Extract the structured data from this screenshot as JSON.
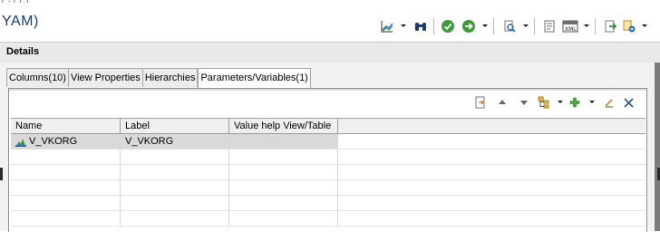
{
  "header": {
    "title": "YAM)",
    "cutoff_text": "/ . / / \\"
  },
  "toolbar_icons": [
    "chart-icon",
    "dropdown-arrow",
    "binoculars-icon",
    "validate-icon",
    "run-icon",
    "dropdown-arrow",
    "data-preview-icon",
    "dropdown-arrow",
    "copy-icon",
    "xml-icon",
    "dropdown-arrow",
    "import-icon",
    "deploy-icon",
    "dropdown-arrow"
  ],
  "details": {
    "title": "Details"
  },
  "tabs": [
    {
      "label": "Columns(10)"
    },
    {
      "label": "View Properties"
    },
    {
      "label": "Hierarchies"
    },
    {
      "label": "Parameters/Variables(1)",
      "active": true
    }
  ],
  "inner_toolbar_icons": [
    "export-icon",
    "move-up-icon",
    "move-down-icon",
    "hierarchy-icon",
    "dropdown-arrow",
    "add-icon",
    "dropdown-arrow",
    "edit-icon",
    "delete-icon"
  ],
  "table": {
    "columns": [
      "Name",
      "Label",
      "Value help View/Table"
    ],
    "rows": [
      {
        "name": "V_VKORG",
        "label": "V_VKORG",
        "value_help": "",
        "icon": "variable-icon"
      }
    ]
  },
  "colors": {
    "title": "#1c3f73",
    "panel": "#f2f2f2",
    "selected_row": "#d9d9d9"
  }
}
